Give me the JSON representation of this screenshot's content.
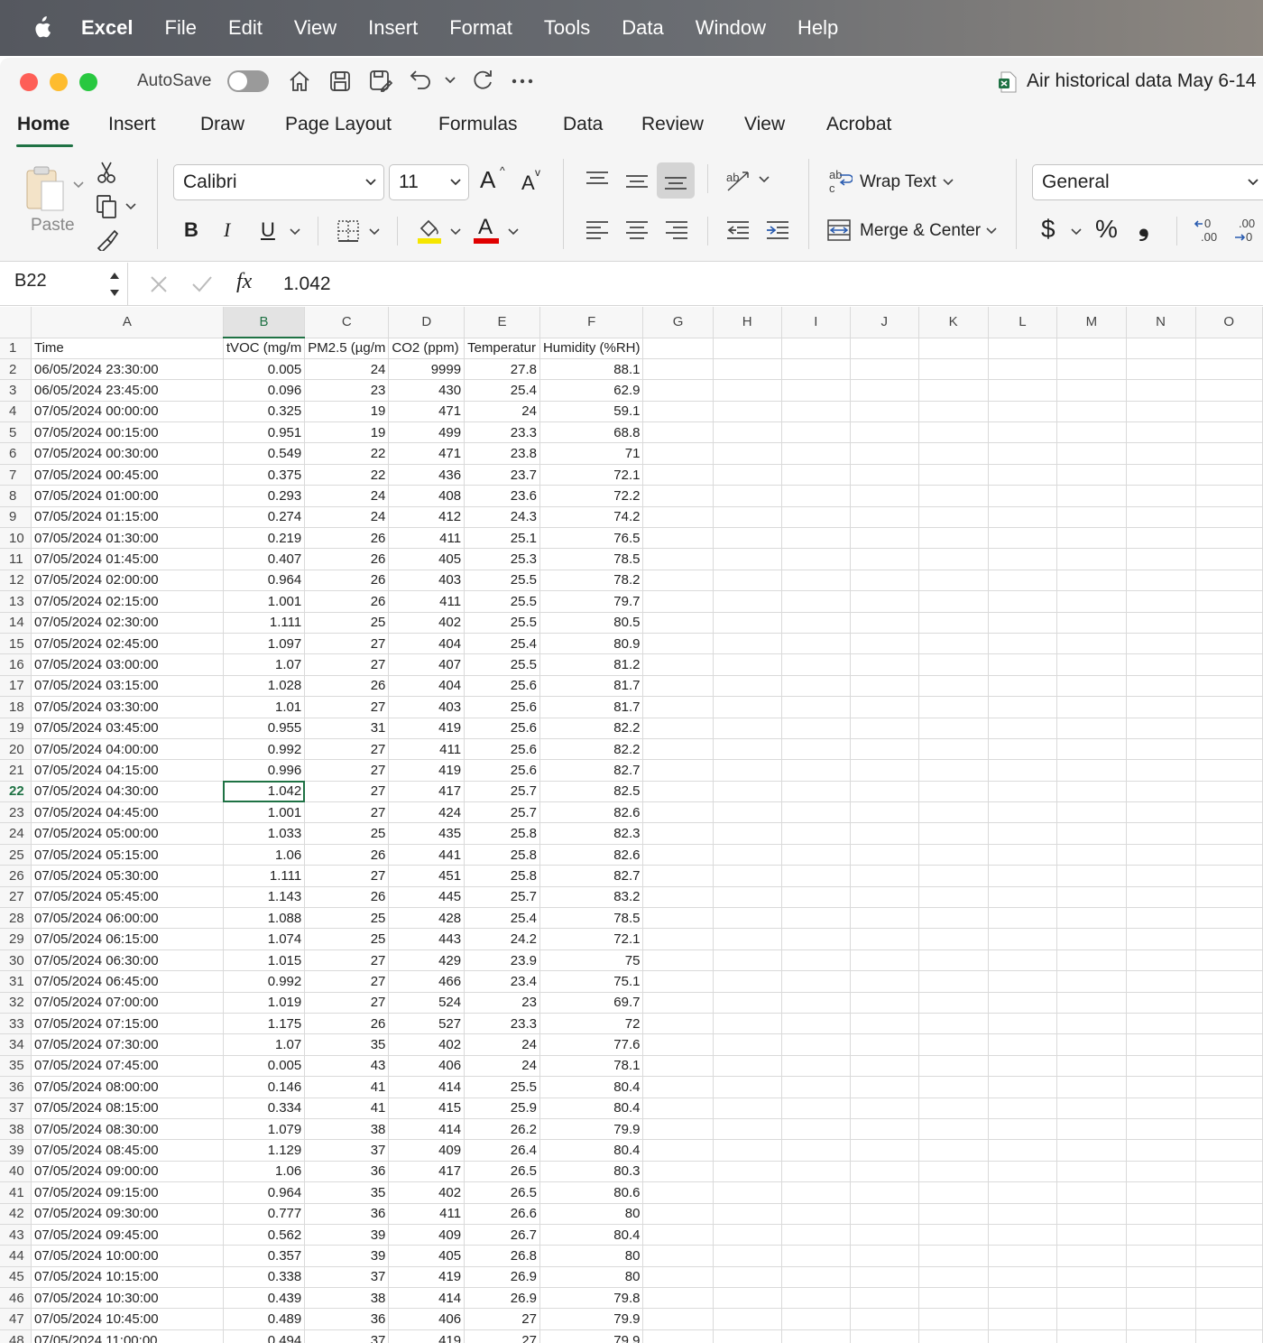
{
  "menubar": {
    "app": "Excel",
    "items": [
      "File",
      "Edit",
      "View",
      "Insert",
      "Format",
      "Tools",
      "Data",
      "Window",
      "Help"
    ]
  },
  "titlebar": {
    "autosave_label": "AutoSave",
    "doc_title": "Air historical data May 6-14"
  },
  "tabs": [
    "Home",
    "Insert",
    "Draw",
    "Page Layout",
    "Formulas",
    "Data",
    "Review",
    "View",
    "Acrobat"
  ],
  "ribbon": {
    "paste_label": "Paste",
    "font_name": "Calibri",
    "font_size": "11",
    "grow_font": "A",
    "shrink_font": "A",
    "bold": "B",
    "italic": "I",
    "underline": "U",
    "font_color_glyph": "A",
    "wrap_text": "Wrap Text",
    "merge_center": "Merge & Center",
    "number_format": "General",
    "currency": "$",
    "percent": "%",
    "comma": "❟",
    "increase_decimal": ".00",
    "decrease_decimal": ".00"
  },
  "colors": {
    "accent": "#1f7244",
    "highlight_yellow": "#f5e600",
    "font_red": "#e00000"
  },
  "formula_bar": {
    "name_box": "B22",
    "fx": "fx",
    "value": "1.042"
  },
  "sheet": {
    "columns": [
      "A",
      "B",
      "C",
      "D",
      "E",
      "F",
      "G",
      "H",
      "I",
      "J",
      "K",
      "L",
      "M",
      "N",
      "O"
    ],
    "selected_cell": "B22",
    "header_row": [
      "Time",
      "tVOC (mg/m",
      "PM2.5 (µg/m",
      "CO2 (ppm)",
      "Temperatur",
      "Humidity (%RH)"
    ],
    "rows": [
      [
        "06/05/2024 23:30:00",
        "0.005",
        "24",
        "9999",
        "27.8",
        "88.1"
      ],
      [
        "06/05/2024 23:45:00",
        "0.096",
        "23",
        "430",
        "25.4",
        "62.9"
      ],
      [
        "07/05/2024 00:00:00",
        "0.325",
        "19",
        "471",
        "24",
        "59.1"
      ],
      [
        "07/05/2024 00:15:00",
        "0.951",
        "19",
        "499",
        "23.3",
        "68.8"
      ],
      [
        "07/05/2024 00:30:00",
        "0.549",
        "22",
        "471",
        "23.8",
        "71"
      ],
      [
        "07/05/2024 00:45:00",
        "0.375",
        "22",
        "436",
        "23.7",
        "72.1"
      ],
      [
        "07/05/2024 01:00:00",
        "0.293",
        "24",
        "408",
        "23.6",
        "72.2"
      ],
      [
        "07/05/2024 01:15:00",
        "0.274",
        "24",
        "412",
        "24.3",
        "74.2"
      ],
      [
        "07/05/2024 01:30:00",
        "0.219",
        "26",
        "411",
        "25.1",
        "76.5"
      ],
      [
        "07/05/2024 01:45:00",
        "0.407",
        "26",
        "405",
        "25.3",
        "78.5"
      ],
      [
        "07/05/2024 02:00:00",
        "0.964",
        "26",
        "403",
        "25.5",
        "78.2"
      ],
      [
        "07/05/2024 02:15:00",
        "1.001",
        "26",
        "411",
        "25.5",
        "79.7"
      ],
      [
        "07/05/2024 02:30:00",
        "1.111",
        "25",
        "402",
        "25.5",
        "80.5"
      ],
      [
        "07/05/2024 02:45:00",
        "1.097",
        "27",
        "404",
        "25.4",
        "80.9"
      ],
      [
        "07/05/2024 03:00:00",
        "1.07",
        "27",
        "407",
        "25.5",
        "81.2"
      ],
      [
        "07/05/2024 03:15:00",
        "1.028",
        "26",
        "404",
        "25.6",
        "81.7"
      ],
      [
        "07/05/2024 03:30:00",
        "1.01",
        "27",
        "403",
        "25.6",
        "81.7"
      ],
      [
        "07/05/2024 03:45:00",
        "0.955",
        "31",
        "419",
        "25.6",
        "82.2"
      ],
      [
        "07/05/2024 04:00:00",
        "0.992",
        "27",
        "411",
        "25.6",
        "82.2"
      ],
      [
        "07/05/2024 04:15:00",
        "0.996",
        "27",
        "419",
        "25.6",
        "82.7"
      ],
      [
        "07/05/2024 04:30:00",
        "1.042",
        "27",
        "417",
        "25.7",
        "82.5"
      ],
      [
        "07/05/2024 04:45:00",
        "1.001",
        "27",
        "424",
        "25.7",
        "82.6"
      ],
      [
        "07/05/2024 05:00:00",
        "1.033",
        "25",
        "435",
        "25.8",
        "82.3"
      ],
      [
        "07/05/2024 05:15:00",
        "1.06",
        "26",
        "441",
        "25.8",
        "82.6"
      ],
      [
        "07/05/2024 05:30:00",
        "1.111",
        "27",
        "451",
        "25.8",
        "82.7"
      ],
      [
        "07/05/2024 05:45:00",
        "1.143",
        "26",
        "445",
        "25.7",
        "83.2"
      ],
      [
        "07/05/2024 06:00:00",
        "1.088",
        "25",
        "428",
        "25.4",
        "78.5"
      ],
      [
        "07/05/2024 06:15:00",
        "1.074",
        "25",
        "443",
        "24.2",
        "72.1"
      ],
      [
        "07/05/2024 06:30:00",
        "1.015",
        "27",
        "429",
        "23.9",
        "75"
      ],
      [
        "07/05/2024 06:45:00",
        "0.992",
        "27",
        "466",
        "23.4",
        "75.1"
      ],
      [
        "07/05/2024 07:00:00",
        "1.019",
        "27",
        "524",
        "23",
        "69.7"
      ],
      [
        "07/05/2024 07:15:00",
        "1.175",
        "26",
        "527",
        "23.3",
        "72"
      ],
      [
        "07/05/2024 07:30:00",
        "1.07",
        "35",
        "402",
        "24",
        "77.6"
      ],
      [
        "07/05/2024 07:45:00",
        "0.005",
        "43",
        "406",
        "24",
        "78.1"
      ],
      [
        "07/05/2024 08:00:00",
        "0.146",
        "41",
        "414",
        "25.5",
        "80.4"
      ],
      [
        "07/05/2024 08:15:00",
        "0.334",
        "41",
        "415",
        "25.9",
        "80.4"
      ],
      [
        "07/05/2024 08:30:00",
        "1.079",
        "38",
        "414",
        "26.2",
        "79.9"
      ],
      [
        "07/05/2024 08:45:00",
        "1.129",
        "37",
        "409",
        "26.4",
        "80.4"
      ],
      [
        "07/05/2024 09:00:00",
        "1.06",
        "36",
        "417",
        "26.5",
        "80.3"
      ],
      [
        "07/05/2024 09:15:00",
        "0.964",
        "35",
        "402",
        "26.5",
        "80.6"
      ],
      [
        "07/05/2024 09:30:00",
        "0.777",
        "36",
        "411",
        "26.6",
        "80"
      ],
      [
        "07/05/2024 09:45:00",
        "0.562",
        "39",
        "409",
        "26.7",
        "80.4"
      ],
      [
        "07/05/2024 10:00:00",
        "0.357",
        "39",
        "405",
        "26.8",
        "80"
      ],
      [
        "07/05/2024 10:15:00",
        "0.338",
        "37",
        "419",
        "26.9",
        "80"
      ],
      [
        "07/05/2024 10:30:00",
        "0.439",
        "38",
        "414",
        "26.9",
        "79.8"
      ],
      [
        "07/05/2024 10:45:00",
        "0.489",
        "36",
        "406",
        "27",
        "79.9"
      ],
      [
        "07/05/2024 11:00:00",
        "0.494",
        "37",
        "419",
        "27",
        "79.9"
      ]
    ]
  }
}
